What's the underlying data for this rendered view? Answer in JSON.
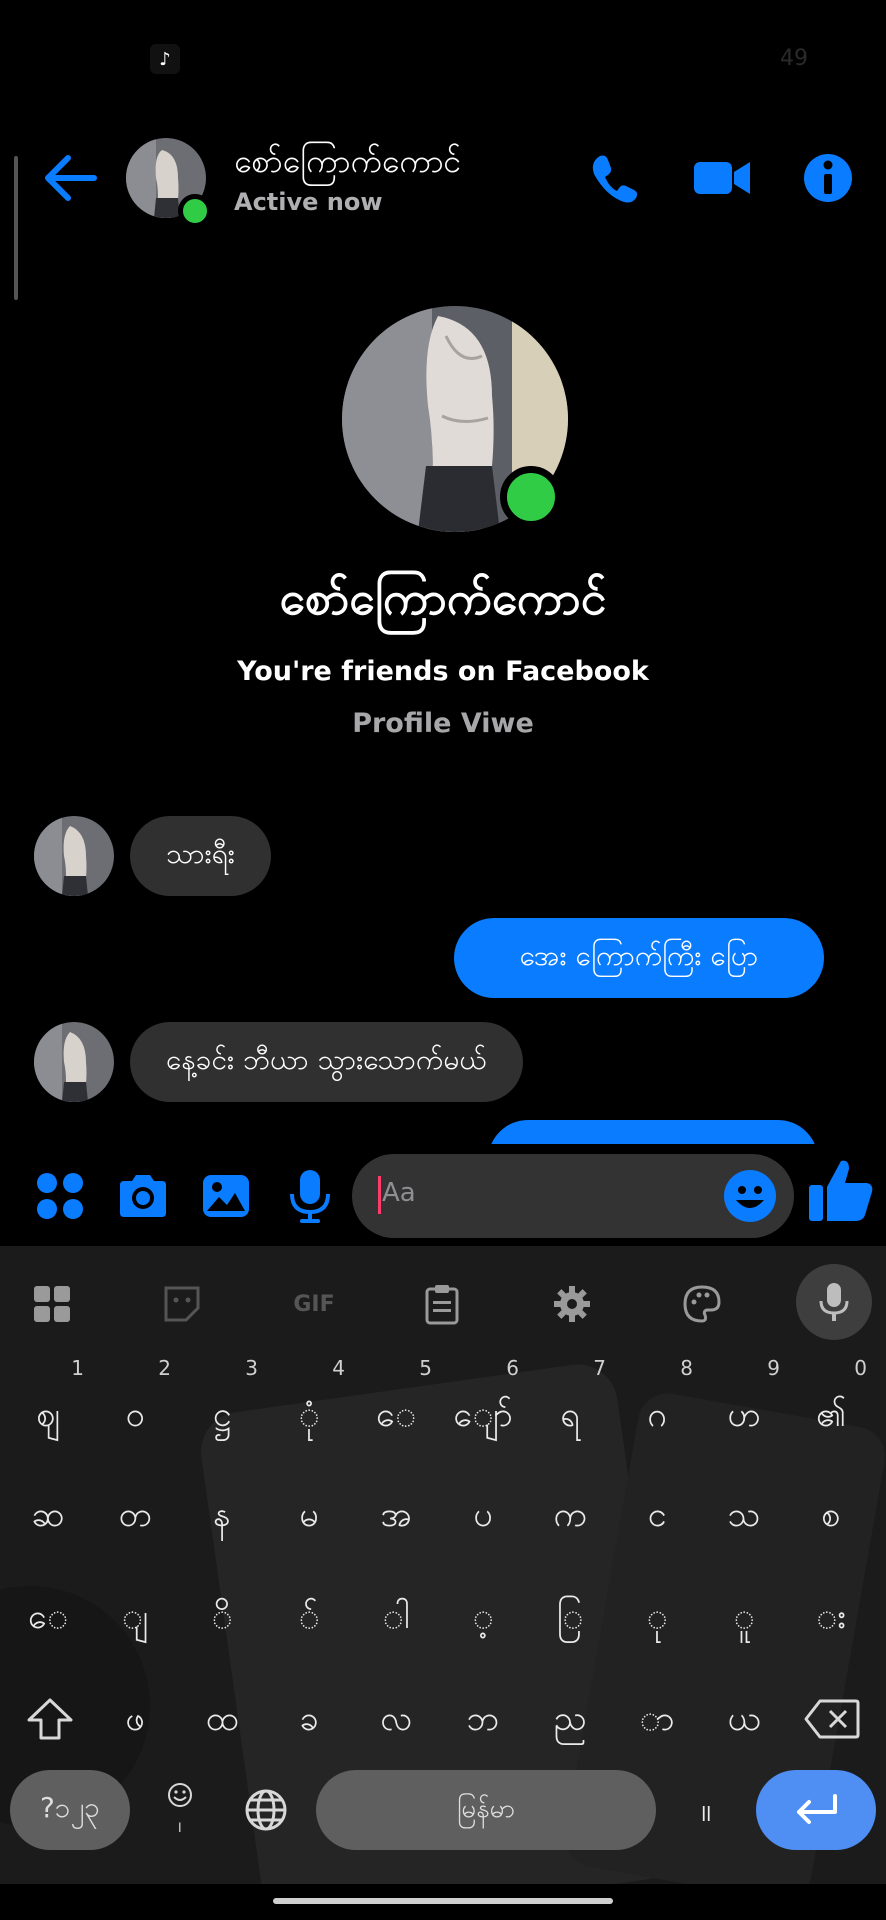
{
  "status_bar": {
    "app_icon": "tiktok-icon",
    "right_text": "49"
  },
  "header": {
    "contact_name": "စော်ကြောက်ကောင်",
    "status": "Active now",
    "icons": [
      "back-arrow-icon",
      "phone-icon",
      "video-camera-icon",
      "info-icon"
    ],
    "accent_color": "#0a7cff"
  },
  "profile": {
    "name": "စော်ကြောက်ကောင်",
    "friends_text": "You're friends on Facebook",
    "profile_link": "Profile Viwe"
  },
  "messages": [
    {
      "direction": "incoming",
      "text": "သားရီး"
    },
    {
      "direction": "outgoing",
      "text": "အေး ကြောက်ကြီး ပြော"
    },
    {
      "direction": "incoming",
      "text": "နေ့ခင်း ဘီယာ သွားသောက်မယ်"
    }
  ],
  "composer": {
    "placeholder": "Aa",
    "icons": [
      "apps-grid-icon",
      "camera-icon",
      "gallery-icon",
      "microphone-icon",
      "emoji-icon",
      "thumbs-up-icon"
    ]
  },
  "keyboard": {
    "toolbar_icons": [
      "apps-grid-icon",
      "sticker-icon",
      "gif-icon",
      "clipboard-icon",
      "settings-gear-icon",
      "palette-icon",
      "microphone-icon"
    ],
    "gif_label": "GIF",
    "row1": [
      {
        "char": "ဈ",
        "hint": "1"
      },
      {
        "char": "ဝ",
        "hint": "2"
      },
      {
        "char": "ဋ္ဌ",
        "hint": "3"
      },
      {
        "char": "ုံ",
        "hint": "4"
      },
      {
        "char": "ေ",
        "hint": "5"
      },
      {
        "char": "ျော်",
        "hint": "6"
      },
      {
        "char": "ရ",
        "hint": "7"
      },
      {
        "char": "ဂ",
        "hint": "8"
      },
      {
        "char": "ဟ",
        "hint": "9"
      },
      {
        "char": "၏",
        "hint": "0"
      }
    ],
    "row2": [
      "ဆ",
      "တ",
      "န",
      "မ",
      "အ",
      "ပ",
      "က",
      "င",
      "သ",
      "စ"
    ],
    "row3": [
      "ေ",
      "ျ",
      "ိ",
      "်",
      "ါ",
      "့",
      "ြ",
      "ု",
      "ူ",
      "း"
    ],
    "row4": [
      "ဖ",
      "ထ",
      "ခ",
      "လ",
      "ဘ",
      "ည",
      "ာ",
      "ယ"
    ],
    "symbols_label": "?၁၂၃",
    "space_label": "မြန်မာ",
    "period_label": "။",
    "emoji_sub_label": "၊"
  }
}
